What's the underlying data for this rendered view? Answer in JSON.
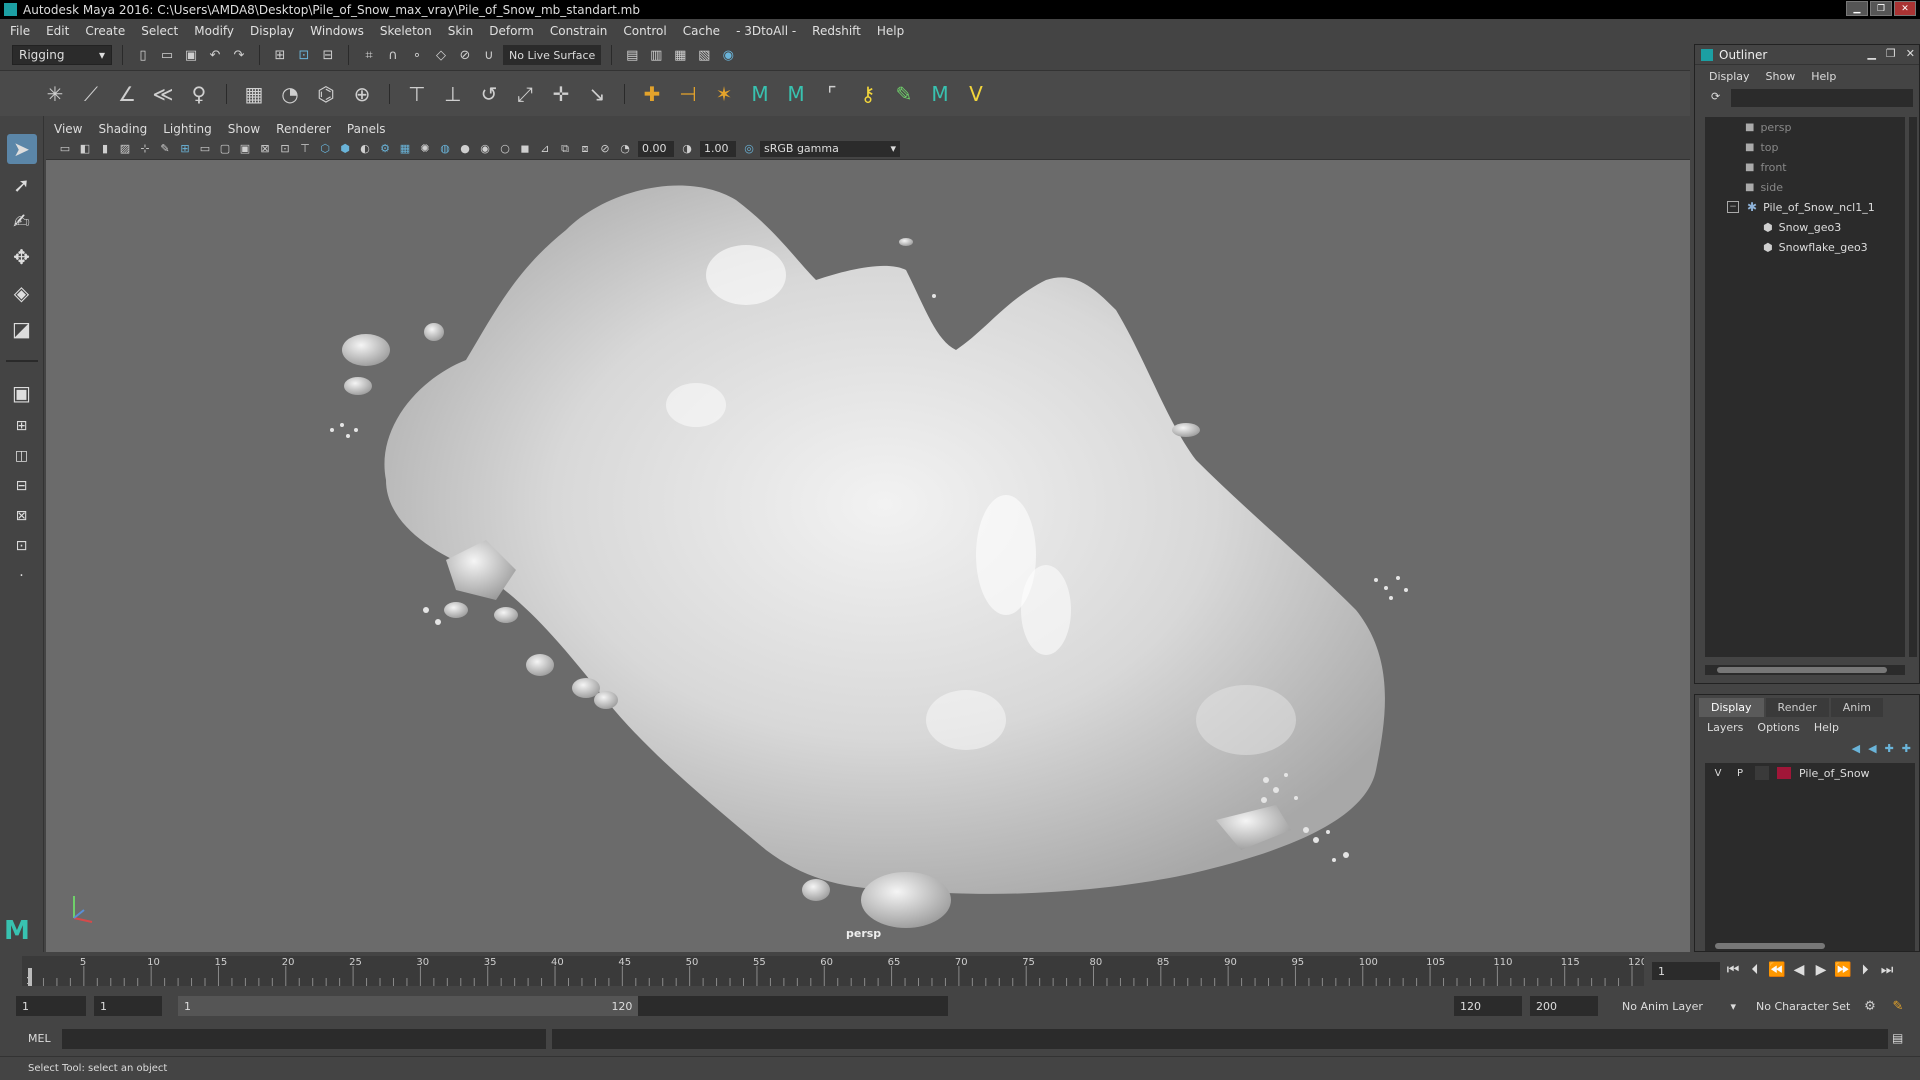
{
  "window": {
    "title": "Autodesk Maya 2016: C:\\Users\\AMDA8\\Desktop\\Pile_of_Snow_max_vray\\Pile_of_Snow_mb_standart.mb"
  },
  "menubar": [
    "File",
    "Edit",
    "Create",
    "Select",
    "Modify",
    "Display",
    "Windows",
    "Skeleton",
    "Skin",
    "Deform",
    "Constrain",
    "Control",
    "Cache",
    "- 3DtoAll -",
    "Redshift",
    "Help"
  ],
  "statusline": {
    "mode": "Rigging",
    "live_surface": "No Live Surface"
  },
  "viewport": {
    "menu": [
      "View",
      "Shading",
      "Lighting",
      "Show",
      "Renderer",
      "Panels"
    ],
    "exposure": "0.00",
    "gamma": "1.00",
    "color_space": "sRGB gamma",
    "camera_label": "persp",
    "background_color": "#6b6b6b"
  },
  "timeline": {
    "ticks": [
      "5",
      "10",
      "15",
      "20",
      "25",
      "30",
      "35",
      "40",
      "45",
      "50",
      "55",
      "60",
      "65",
      "70",
      "75",
      "80",
      "85",
      "90",
      "95",
      "100",
      "105",
      "110",
      "115",
      "120"
    ],
    "start_label": "1",
    "current_frame": "1"
  },
  "range": {
    "start": "1",
    "anim_start": "1",
    "slider_start": "1",
    "slider_end": "120",
    "end": "120",
    "anim_end": "200",
    "anim_layer": "No Anim Layer",
    "character_set": "No Character Set"
  },
  "cmdline": {
    "label": "MEL"
  },
  "helpline": {
    "text": "Select Tool: select an object"
  },
  "outliner": {
    "title": "Outliner",
    "menu": [
      "Display",
      "Show",
      "Help"
    ],
    "cameras": [
      "persp",
      "top",
      "front",
      "side"
    ],
    "group": "Pile_of_Snow_ncl1_1",
    "children": [
      "Snow_geo3",
      "Snowflake_geo3"
    ]
  },
  "layers": {
    "tabs": [
      "Display",
      "Render",
      "Anim"
    ],
    "menu": [
      "Layers",
      "Options",
      "Help"
    ],
    "rows": [
      {
        "v": "V",
        "p": "P",
        "name": "Pile_of_Snow",
        "color": "#a01638"
      }
    ]
  }
}
